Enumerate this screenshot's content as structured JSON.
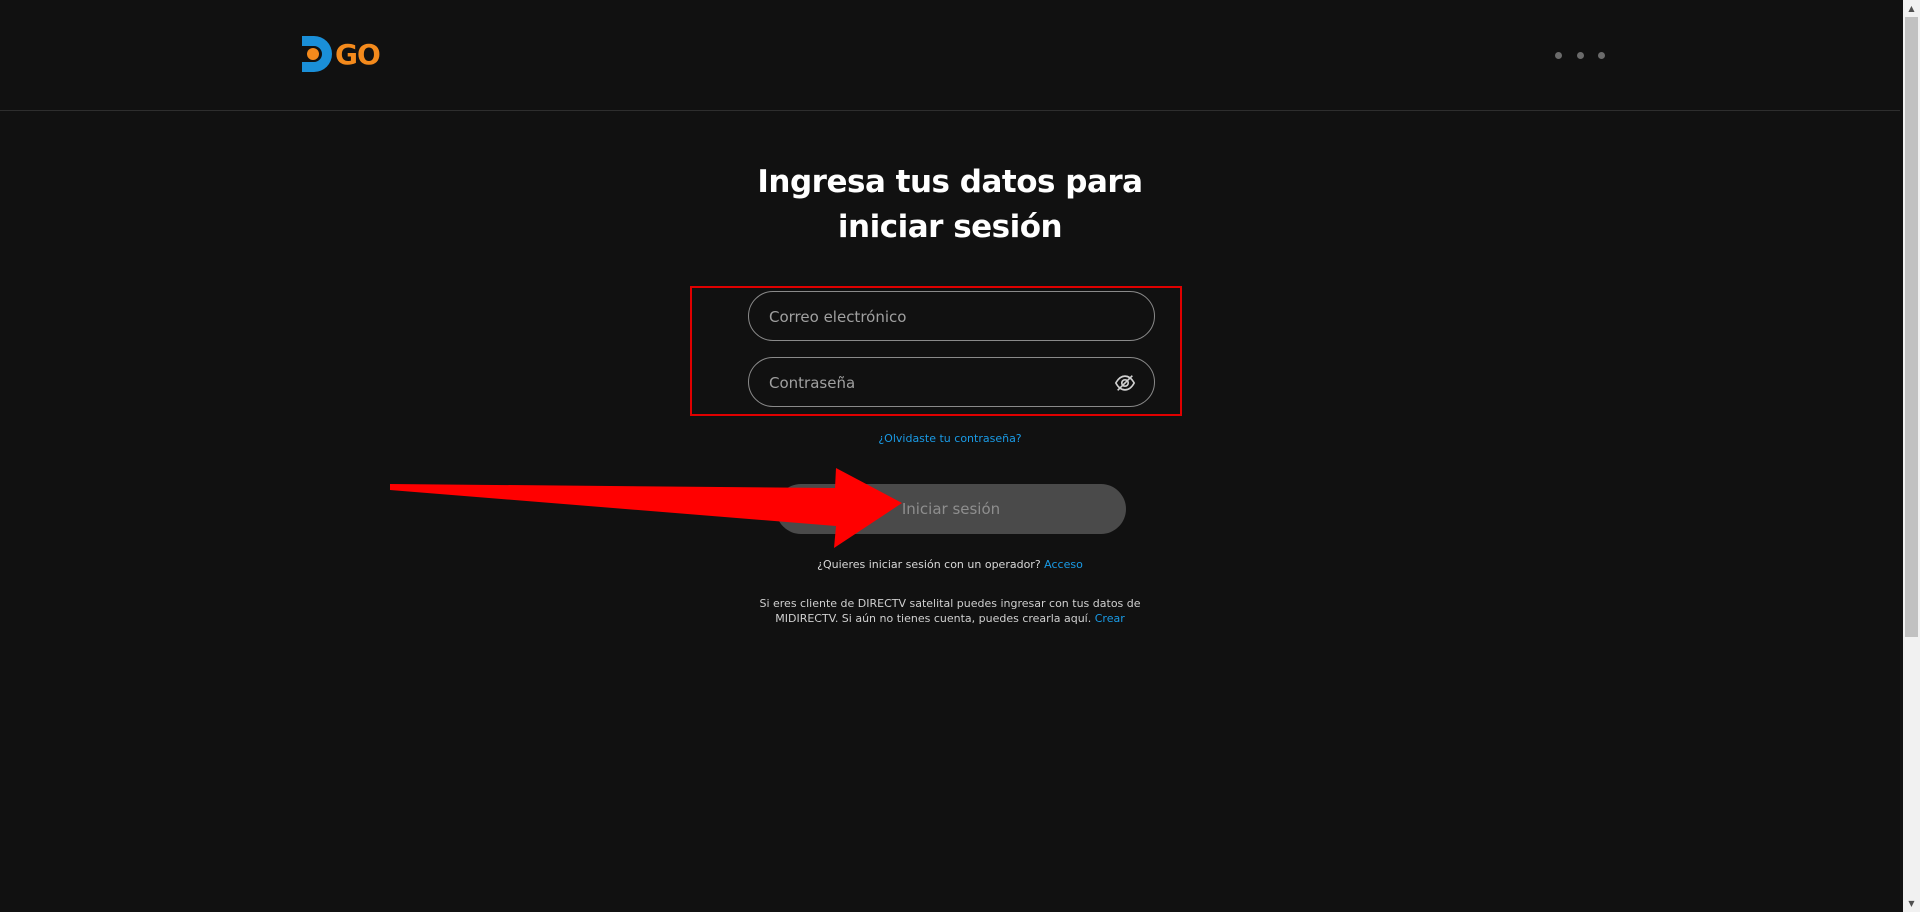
{
  "header": {
    "logo_text": "GO",
    "logo_icon": "dgo-d-icon",
    "menu_icon": "more-horizontal-icon"
  },
  "title": {
    "line1": "Ingresa tus datos para",
    "line2": "iniciar sesión"
  },
  "form": {
    "email_placeholder": "Correo electrónico",
    "email_value": "",
    "password_placeholder": "Contraseña",
    "password_value": "",
    "password_toggle_icon": "eye-off-icon"
  },
  "links": {
    "forgot_password": "¿Olvidaste tu contraseña?"
  },
  "login_button": {
    "label": "Iniciar sesión"
  },
  "operator": {
    "question": "¿Quieres iniciar sesión con un operador?",
    "link": "Acceso"
  },
  "directv_note": {
    "text": "Si eres cliente de DIRECTV satelital puedes ingresar con tus datos de MIDIRECTV. Si aún no tienes cuenta, puedes crearla aquí.",
    "link": "Crear"
  },
  "annotations": {
    "highlight_color": "#e00000",
    "arrow_color": "#ff0000"
  },
  "colors": {
    "background": "#111111",
    "accent_blue": "#1a9be6",
    "logo_orange": "#f48a1c",
    "logo_blue": "#1a8fd8"
  }
}
